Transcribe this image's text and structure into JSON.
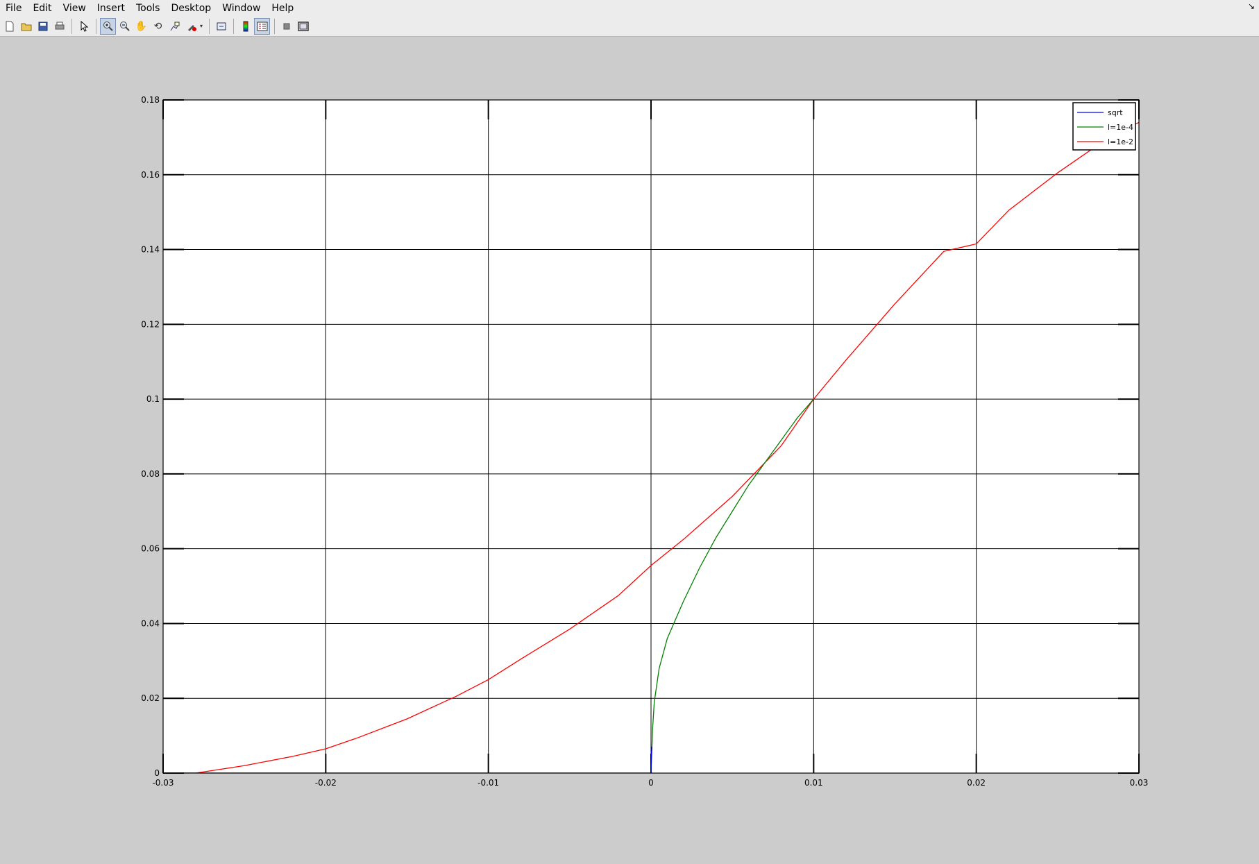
{
  "menu": {
    "items": [
      "File",
      "Edit",
      "View",
      "Insert",
      "Tools",
      "Desktop",
      "Window",
      "Help"
    ],
    "undock_icon": "undock-arrow-icon"
  },
  "toolbar": {
    "buttons": [
      {
        "name": "new-figure",
        "icon": "new-file-icon"
      },
      {
        "name": "open-file",
        "icon": "folder-icon"
      },
      {
        "name": "save-figure",
        "icon": "save-disk-icon"
      },
      {
        "name": "print-figure",
        "icon": "printer-icon"
      },
      {
        "name": "edit-plot",
        "icon": "pointer-arrow-icon"
      },
      {
        "name": "zoom-in",
        "icon": "zoom-in-icon",
        "pressed": true
      },
      {
        "name": "zoom-out",
        "icon": "zoom-out-icon"
      },
      {
        "name": "pan",
        "icon": "hand-icon"
      },
      {
        "name": "rotate-3d",
        "icon": "rotate-icon"
      },
      {
        "name": "data-cursor",
        "icon": "data-cursor-icon"
      },
      {
        "name": "brush",
        "icon": "brush-icon"
      },
      {
        "name": "link-plot",
        "icon": "link-icon"
      },
      {
        "name": "insert-colorbar",
        "icon": "colorbar-icon"
      },
      {
        "name": "insert-legend",
        "icon": "legend-icon",
        "pressed": true
      },
      {
        "name": "hide-plot-tools",
        "icon": "hide-tools-icon"
      },
      {
        "name": "show-plot-tools",
        "icon": "show-tools-icon"
      }
    ]
  },
  "chart_data": {
    "type": "line",
    "title": "",
    "xlabel": "",
    "ylabel": "",
    "xlim": [
      -0.03,
      0.03
    ],
    "ylim": [
      0,
      0.18
    ],
    "grid": true,
    "legend_position": "top-right",
    "xticks": [
      "-0.03",
      "-0.02",
      "-0.01",
      "0",
      "0.01",
      "0.02",
      "0.03"
    ],
    "yticks": [
      "0",
      "0.02",
      "0.04",
      "0.06",
      "0.08",
      "0.1",
      "0.12",
      "0.14",
      "0.16",
      "0.18"
    ],
    "series": [
      {
        "name": "sqrt",
        "color": "#0000ff",
        "x": [
          -0.03,
          -0.0002,
          -0.0001,
          0,
          2e-05,
          5e-05
        ],
        "y": [
          0,
          0,
          0,
          0,
          0.0045,
          0.007
        ]
      },
      {
        "name": "l=1e-4",
        "color": "#008000",
        "x": [
          -0.03,
          -0.0001,
          0,
          0.0001,
          0.0002,
          0.0005,
          0.001,
          0.002,
          0.003,
          0.004,
          0.005,
          0.006,
          0.007,
          0.008,
          0.009,
          0.01
        ],
        "y": [
          0,
          0,
          0,
          0.012,
          0.019,
          0.028,
          0.036,
          0.046,
          0.055,
          0.063,
          0.07,
          0.077,
          0.083,
          0.089,
          0.095,
          0.1
        ]
      },
      {
        "name": "l=1e-2",
        "color": "#ff0000",
        "x": [
          -0.03,
          -0.028,
          -0.025,
          -0.022,
          -0.02,
          -0.018,
          -0.015,
          -0.012,
          -0.01,
          -0.008,
          -0.005,
          -0.002,
          0,
          0.002,
          0.005,
          0.008,
          0.01,
          0.012,
          0.015,
          0.018,
          0.02,
          0.022,
          0.025,
          0.028,
          0.03
        ],
        "y": [
          0,
          0,
          0.002,
          0.0045,
          0.0065,
          0.0095,
          0.0145,
          0.0205,
          0.025,
          0.0305,
          0.0385,
          0.0475,
          0.0555,
          0.0625,
          0.074,
          0.0875,
          0.1,
          0.1105,
          0.1255,
          0.1395,
          0.1415,
          0.1505,
          0.1605,
          0.1695,
          0.174
        ]
      }
    ]
  }
}
